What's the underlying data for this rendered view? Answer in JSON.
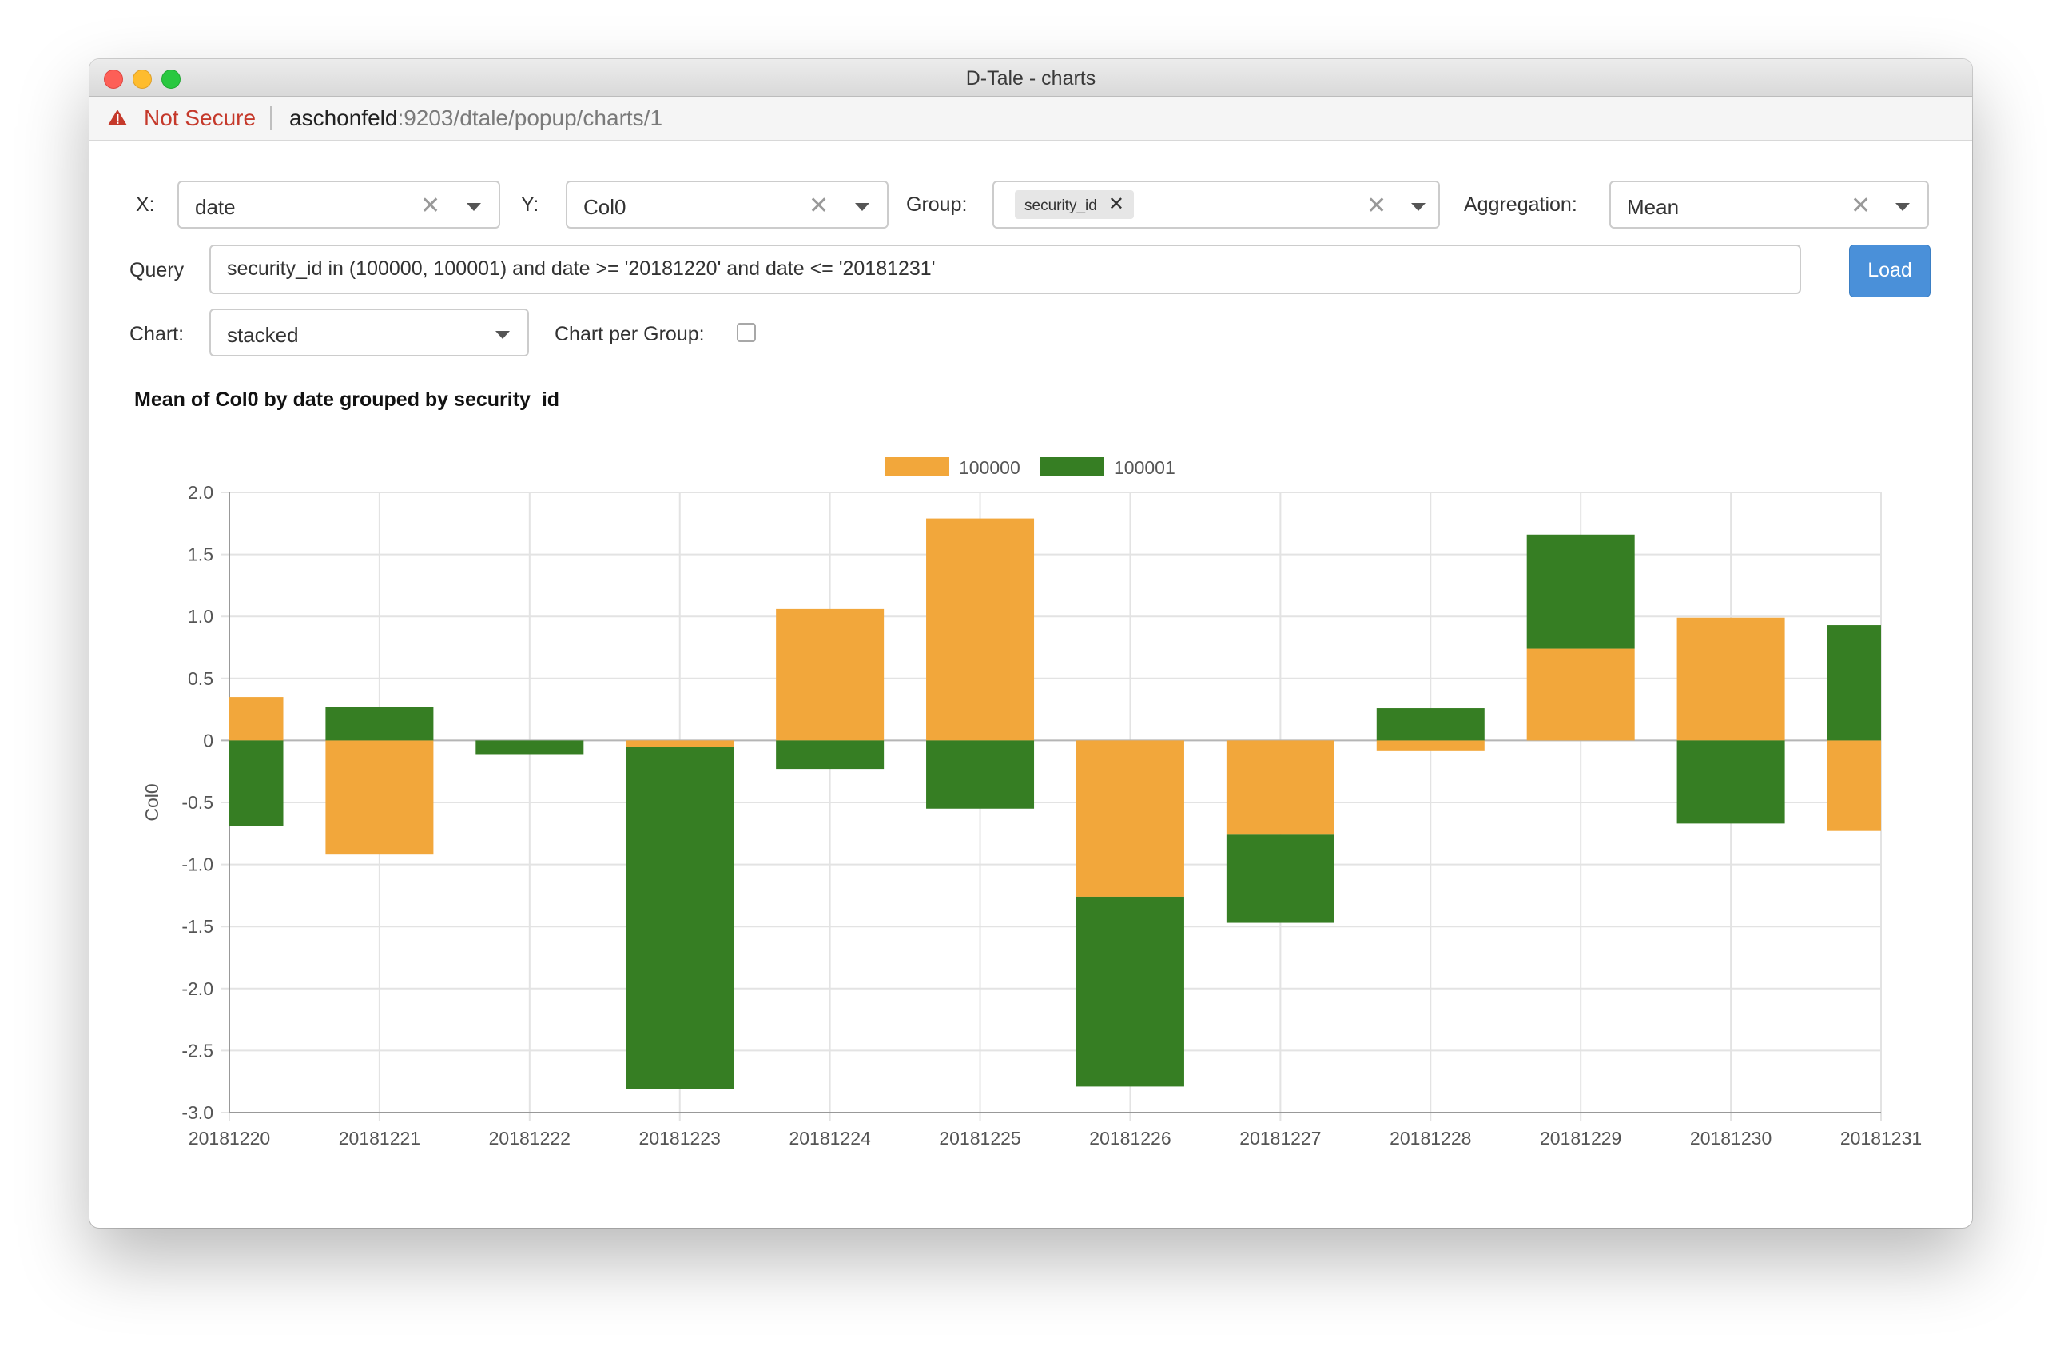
{
  "window": {
    "title": "D-Tale - charts"
  },
  "addressbar": {
    "security_label": "Not Secure",
    "url_host": "aschonfeld",
    "url_rest": ":9203/dtale/popup/charts/1"
  },
  "controls": {
    "x_label": "X:",
    "x_value": "date",
    "y_label": "Y:",
    "y_value": "Col0",
    "group_label": "Group:",
    "group_tag": "security_id",
    "aggregation_label": "Aggregation:",
    "aggregation_value": "Mean",
    "query_label": "Query",
    "query_value": "security_id in (100000, 100001) and date >= '20181220' and date <= '20181231'",
    "load_label": "Load",
    "chart_label": "Chart:",
    "chart_value": "stacked",
    "chart_per_group_label": "Chart per Group:",
    "chart_per_group_checked": false
  },
  "chart_data": {
    "type": "bar",
    "stacked": true,
    "title": "Mean of Col0 by date grouped by security_id",
    "xlabel": "",
    "ylabel": "Col0",
    "ylim": [
      -3.0,
      2.0
    ],
    "yticks": [
      "2.0",
      "1.5",
      "1.0",
      "0.5",
      "0",
      "-0.5",
      "-1.0",
      "-1.5",
      "-2.0",
      "-2.5",
      "-3.0"
    ],
    "categories": [
      "20181220",
      "20181221",
      "20181222",
      "20181223",
      "20181224",
      "20181225",
      "20181226",
      "20181227",
      "20181228",
      "20181229",
      "20181230",
      "20181231"
    ],
    "series": [
      {
        "name": "100000",
        "color": "#f2a73b",
        "values": [
          0.35,
          -0.92,
          0.0,
          -0.05,
          1.06,
          1.79,
          -1.26,
          -0.76,
          -0.08,
          0.74,
          0.99,
          -0.73
        ]
      },
      {
        "name": "100001",
        "color": "#367e23",
        "values": [
          -0.69,
          0.27,
          -0.11,
          -2.76,
          -0.23,
          -0.55,
          -1.53,
          -0.71,
          0.26,
          0.92,
          -0.67,
          0.93
        ]
      }
    ],
    "grid": true,
    "legend": "top-center"
  }
}
